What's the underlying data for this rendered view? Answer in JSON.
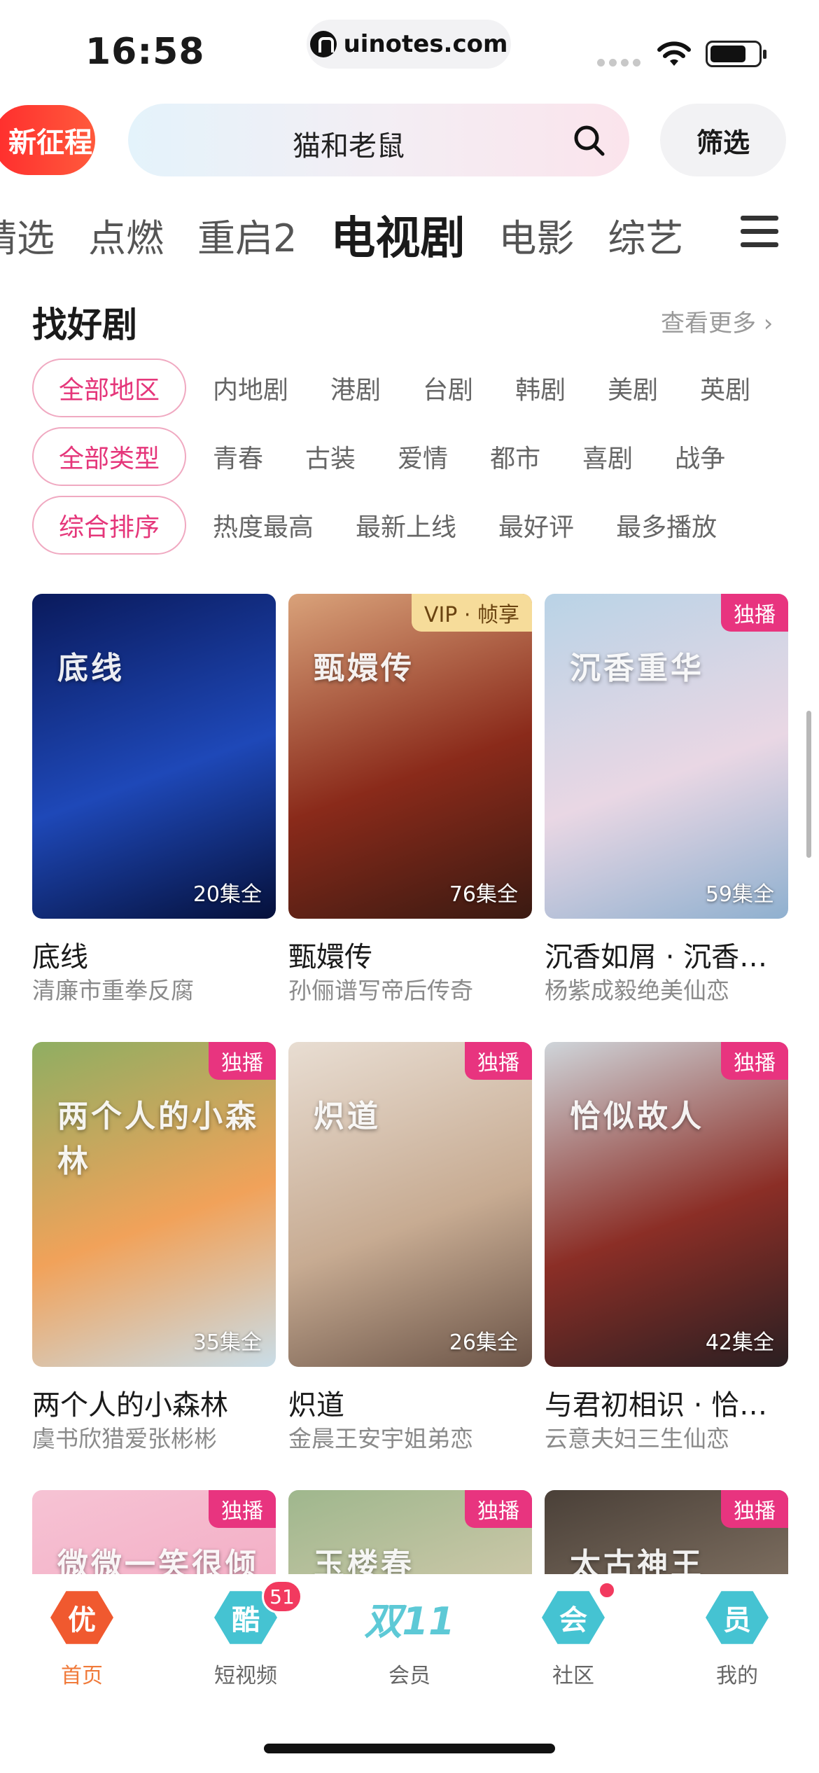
{
  "status_bar": {
    "time": "16:58",
    "url": "uinotes.com"
  },
  "header": {
    "promo_label": "新征程",
    "search_query": "猫和老鼠",
    "filter_label": "筛选"
  },
  "tabs": [
    {
      "label": "精选"
    },
    {
      "label": "点燃"
    },
    {
      "label": "重启2"
    },
    {
      "label": "电视剧",
      "active": true
    },
    {
      "label": "电影"
    },
    {
      "label": "综艺"
    }
  ],
  "section": {
    "title": "找好剧",
    "more": "查看更多 ›"
  },
  "filters": {
    "region": {
      "selected": "全部地区",
      "options": [
        "内地剧",
        "港剧",
        "台剧",
        "韩剧",
        "美剧",
        "英剧"
      ]
    },
    "genre": {
      "selected": "全部类型",
      "options": [
        "青春",
        "古装",
        "爱情",
        "都市",
        "喜剧",
        "战争"
      ]
    },
    "sort": {
      "selected": "综合排序",
      "options": [
        "热度最高",
        "最新上线",
        "最好评",
        "最多播放"
      ]
    }
  },
  "shows": [
    {
      "title": "底线",
      "subtitle": "清廉市重拳反腐",
      "episodes": "20集全",
      "badge": "",
      "poster_text": "底线",
      "bg": [
        "#0a1a5c",
        "#1e48b8",
        "#05103a"
      ]
    },
    {
      "title": "甄嬛传",
      "subtitle": "孙俪谱写帝后传奇",
      "episodes": "76集全",
      "badge": "VIP · 帧享",
      "poster_text": "甄嬛传",
      "bg": [
        "#d9a27a",
        "#8a2a1a",
        "#3a1a12"
      ]
    },
    {
      "title": "沉香如屑 · 沉香重华",
      "subtitle": "杨紫成毅绝美仙恋",
      "episodes": "59集全",
      "badge": "独播",
      "poster_text": "沉香重华",
      "bg": [
        "#b9d3e6",
        "#e9d7e4",
        "#8fb0cf"
      ]
    },
    {
      "title": "两个人的小森林",
      "subtitle": "虞书欣猎爱张彬彬",
      "episodes": "35集全",
      "badge": "独播",
      "poster_text": "两个人的小森林",
      "bg": [
        "#8fae62",
        "#f1a25a",
        "#c9dde8"
      ]
    },
    {
      "title": "炽道",
      "subtitle": "金晨王安宇姐弟恋",
      "episodes": "26集全",
      "badge": "独播",
      "poster_text": "炽道",
      "bg": [
        "#e8ddd2",
        "#c7ab92",
        "#6b5447"
      ]
    },
    {
      "title": "与君初相识 · 恰似故人归",
      "subtitle": "云意夫妇三生仙恋",
      "episodes": "42集全",
      "badge": "独播",
      "poster_text": "恰似故人",
      "bg": [
        "#cfd5da",
        "#8b2e26",
        "#2a1f22"
      ]
    },
    {
      "title": "",
      "subtitle": "",
      "episodes": "",
      "badge": "独播",
      "poster_text": "微微一笑很倾城",
      "bg": [
        "#f6c3d4",
        "#f3a9c2",
        "#fbe2ea"
      ]
    },
    {
      "title": "",
      "subtitle": "",
      "episodes": "",
      "badge": "独播",
      "poster_text": "玉楼春",
      "bg": [
        "#9fb78d",
        "#d8ccb0",
        "#7a8c68"
      ]
    },
    {
      "title": "",
      "subtitle": "",
      "episodes": "",
      "badge": "独播",
      "poster_text": "太古神王",
      "bg": [
        "#4a4038",
        "#8a7a6a",
        "#2a2522"
      ]
    }
  ],
  "nav": [
    {
      "label": "首页",
      "icon": "优",
      "icon_name": "home-you-icon",
      "active": true,
      "color": "#f0592f"
    },
    {
      "label": "短视频",
      "icon": "酷",
      "icon_name": "short-video-ku-icon",
      "badge": "51",
      "color": "#45c3d2"
    },
    {
      "label": "会员",
      "icon": "双11",
      "icon_name": "double-eleven-icon",
      "color": "#5dc9d6"
    },
    {
      "label": "社区",
      "icon": "会",
      "icon_name": "community-hui-icon",
      "dot": true,
      "color": "#45c3d2"
    },
    {
      "label": "我的",
      "icon": "员",
      "icon_name": "profile-yuan-icon",
      "color": "#45c3d2"
    }
  ]
}
